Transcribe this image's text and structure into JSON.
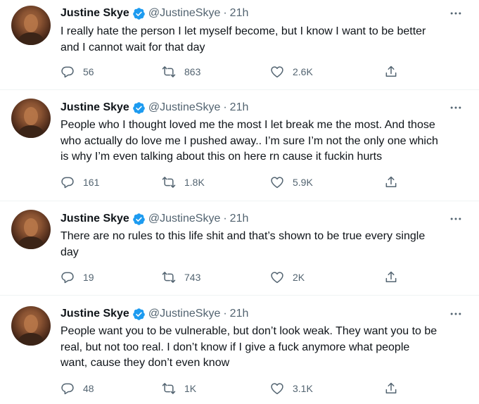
{
  "tweets": [
    {
      "name": "Justine Skye",
      "handle": "@JustineSkye",
      "separator": "·",
      "time": "21h",
      "text_lines": [
        "I really hate the person I let myself become, but I know I want to be better",
        "and I cannot wait for that day"
      ],
      "replies": "56",
      "retweets": "863",
      "likes": "2.6K"
    },
    {
      "name": "Justine Skye",
      "handle": "@JustineSkye",
      "separator": "·",
      "time": "21h",
      "text_lines": [
        "People who I thought loved me the most I let break me the most. And those",
        "who actually do love me I pushed away.. I’m sure I’m not the only one which",
        "is why I’m even talking about this on here rn cause it fuckin hurts"
      ],
      "replies": "161",
      "retweets": "1.8K",
      "likes": "5.9K"
    },
    {
      "name": "Justine Skye",
      "handle": "@JustineSkye",
      "separator": "·",
      "time": "21h",
      "text_lines": [
        "There are no rules to this life shit and that’s shown to be true every single",
        "day"
      ],
      "replies": "19",
      "retweets": "743",
      "likes": "2K"
    },
    {
      "name": "Justine Skye",
      "handle": "@JustineSkye",
      "separator": "·",
      "time": "21h",
      "text_lines": [
        "People want you to be vulnerable, but don’t look weak. They want you to be",
        "real, but not too real. I don’t know if I give a fuck anymore what people",
        "want, cause they don’t even know"
      ],
      "replies": "48",
      "retweets": "1K",
      "likes": "3.1K"
    }
  ],
  "colors": {
    "text": "#0f1419",
    "secondary": "#536471",
    "verified": "#1d9bf0",
    "divider": "#eff3f4"
  },
  "icons": [
    "verified-badge-icon",
    "more-options-icon",
    "reply-icon",
    "retweet-icon",
    "like-icon",
    "share-icon"
  ]
}
